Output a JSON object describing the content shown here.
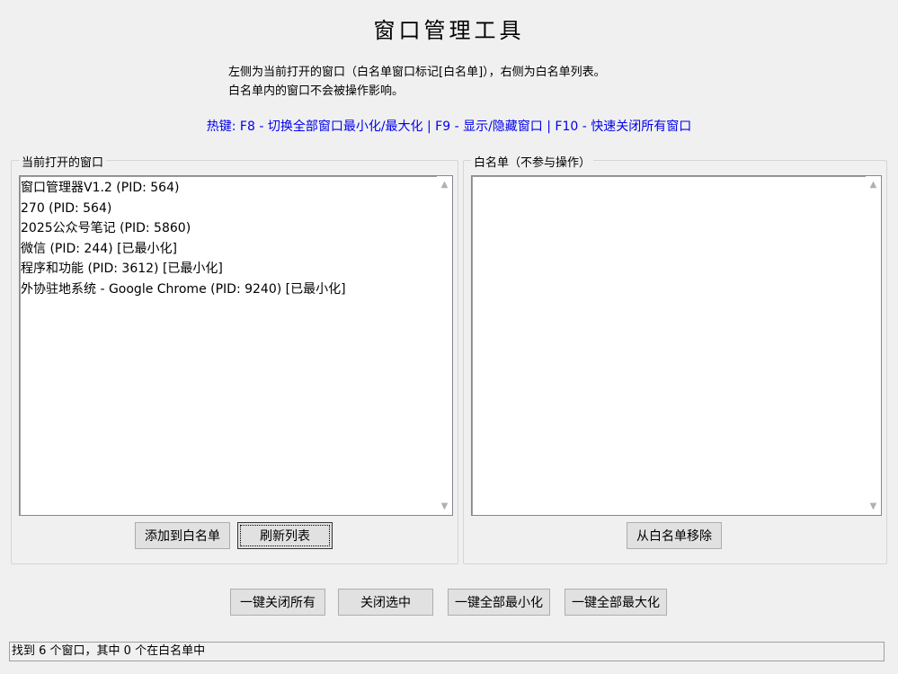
{
  "title": "窗口管理工具",
  "description": {
    "line1": "左侧为当前打开的窗口（白名单窗口标记[白名单]），右侧为白名单列表。",
    "line2": "白名单内的窗口不会被操作影响。"
  },
  "hotkeys": "热键: F8 - 切换全部窗口最小化/最大化 | F9 - 显示/隐藏窗口 | F10 - 快速关闭所有窗口",
  "left_panel": {
    "legend": "当前打开的窗口",
    "items": [
      "窗口管理器V1.2 (PID: 564)",
      "270 (PID: 564)",
      "2025公众号笔记 (PID: 5860)",
      "微信 (PID: 244)  [已最小化]",
      "程序和功能 (PID: 3612)  [已最小化]",
      "外协驻地系统 - Google Chrome (PID: 9240)  [已最小化]"
    ],
    "add_button": "添加到白名单",
    "refresh_button": "刷新列表"
  },
  "right_panel": {
    "legend": "白名单（不参与操作）",
    "items": [],
    "remove_button": "从白名单移除"
  },
  "actions": {
    "close_all": "一键关闭所有",
    "close_selected": "关闭选中",
    "minimize_all": "一键全部最小化",
    "maximize_all": "一键全部最大化"
  },
  "status": "找到 6 个窗口，其中 0 个在白名单中",
  "icons": {
    "scroll_up": "▲",
    "scroll_down": "▼"
  },
  "colors": {
    "hotkey_text": "#0000ee",
    "background": "#f0f0f0"
  }
}
